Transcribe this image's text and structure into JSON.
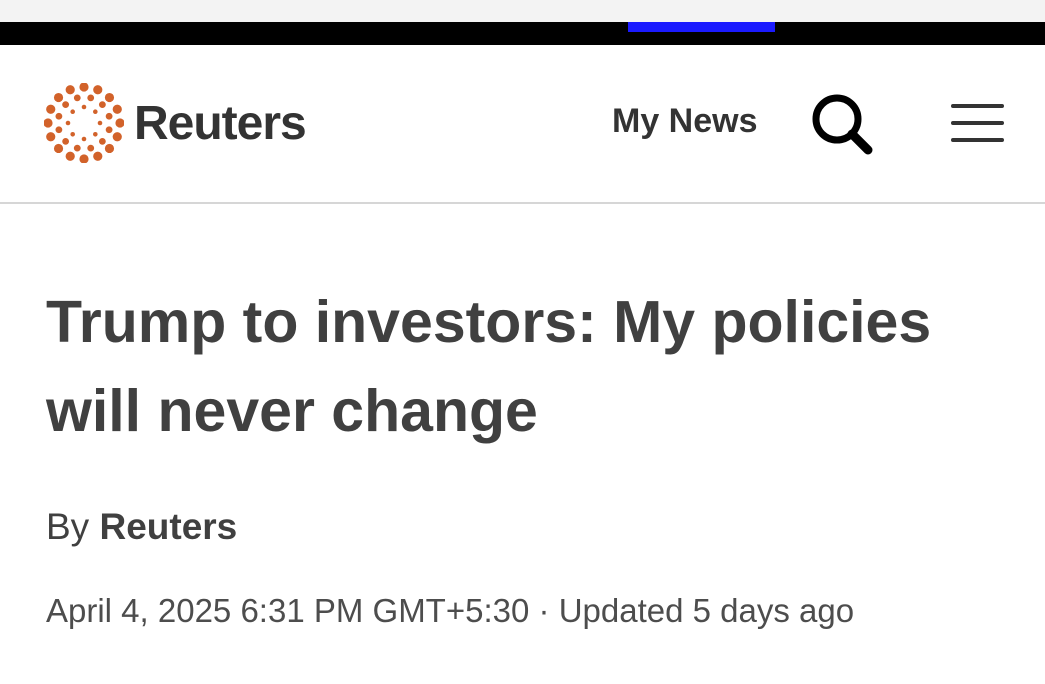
{
  "header": {
    "logo_text": "Reuters",
    "logo_icon": "reuters-dot-ring-icon",
    "my_news_label": "My News",
    "search_icon": "search-icon",
    "menu_icon": "hamburger-menu-icon"
  },
  "article": {
    "headline": "Trump to investors: My policies will never change",
    "byline_prefix": "By",
    "byline_author": "Reuters",
    "published": "April 4, 2025 6:31 PM GMT+5:30",
    "separator": "·",
    "updated": "Updated 5 days ago"
  },
  "colors": {
    "logo_orange": "#d2622a",
    "tab_indicator": "#1a1aff",
    "header_bar": "#000000",
    "text": "#404040"
  }
}
